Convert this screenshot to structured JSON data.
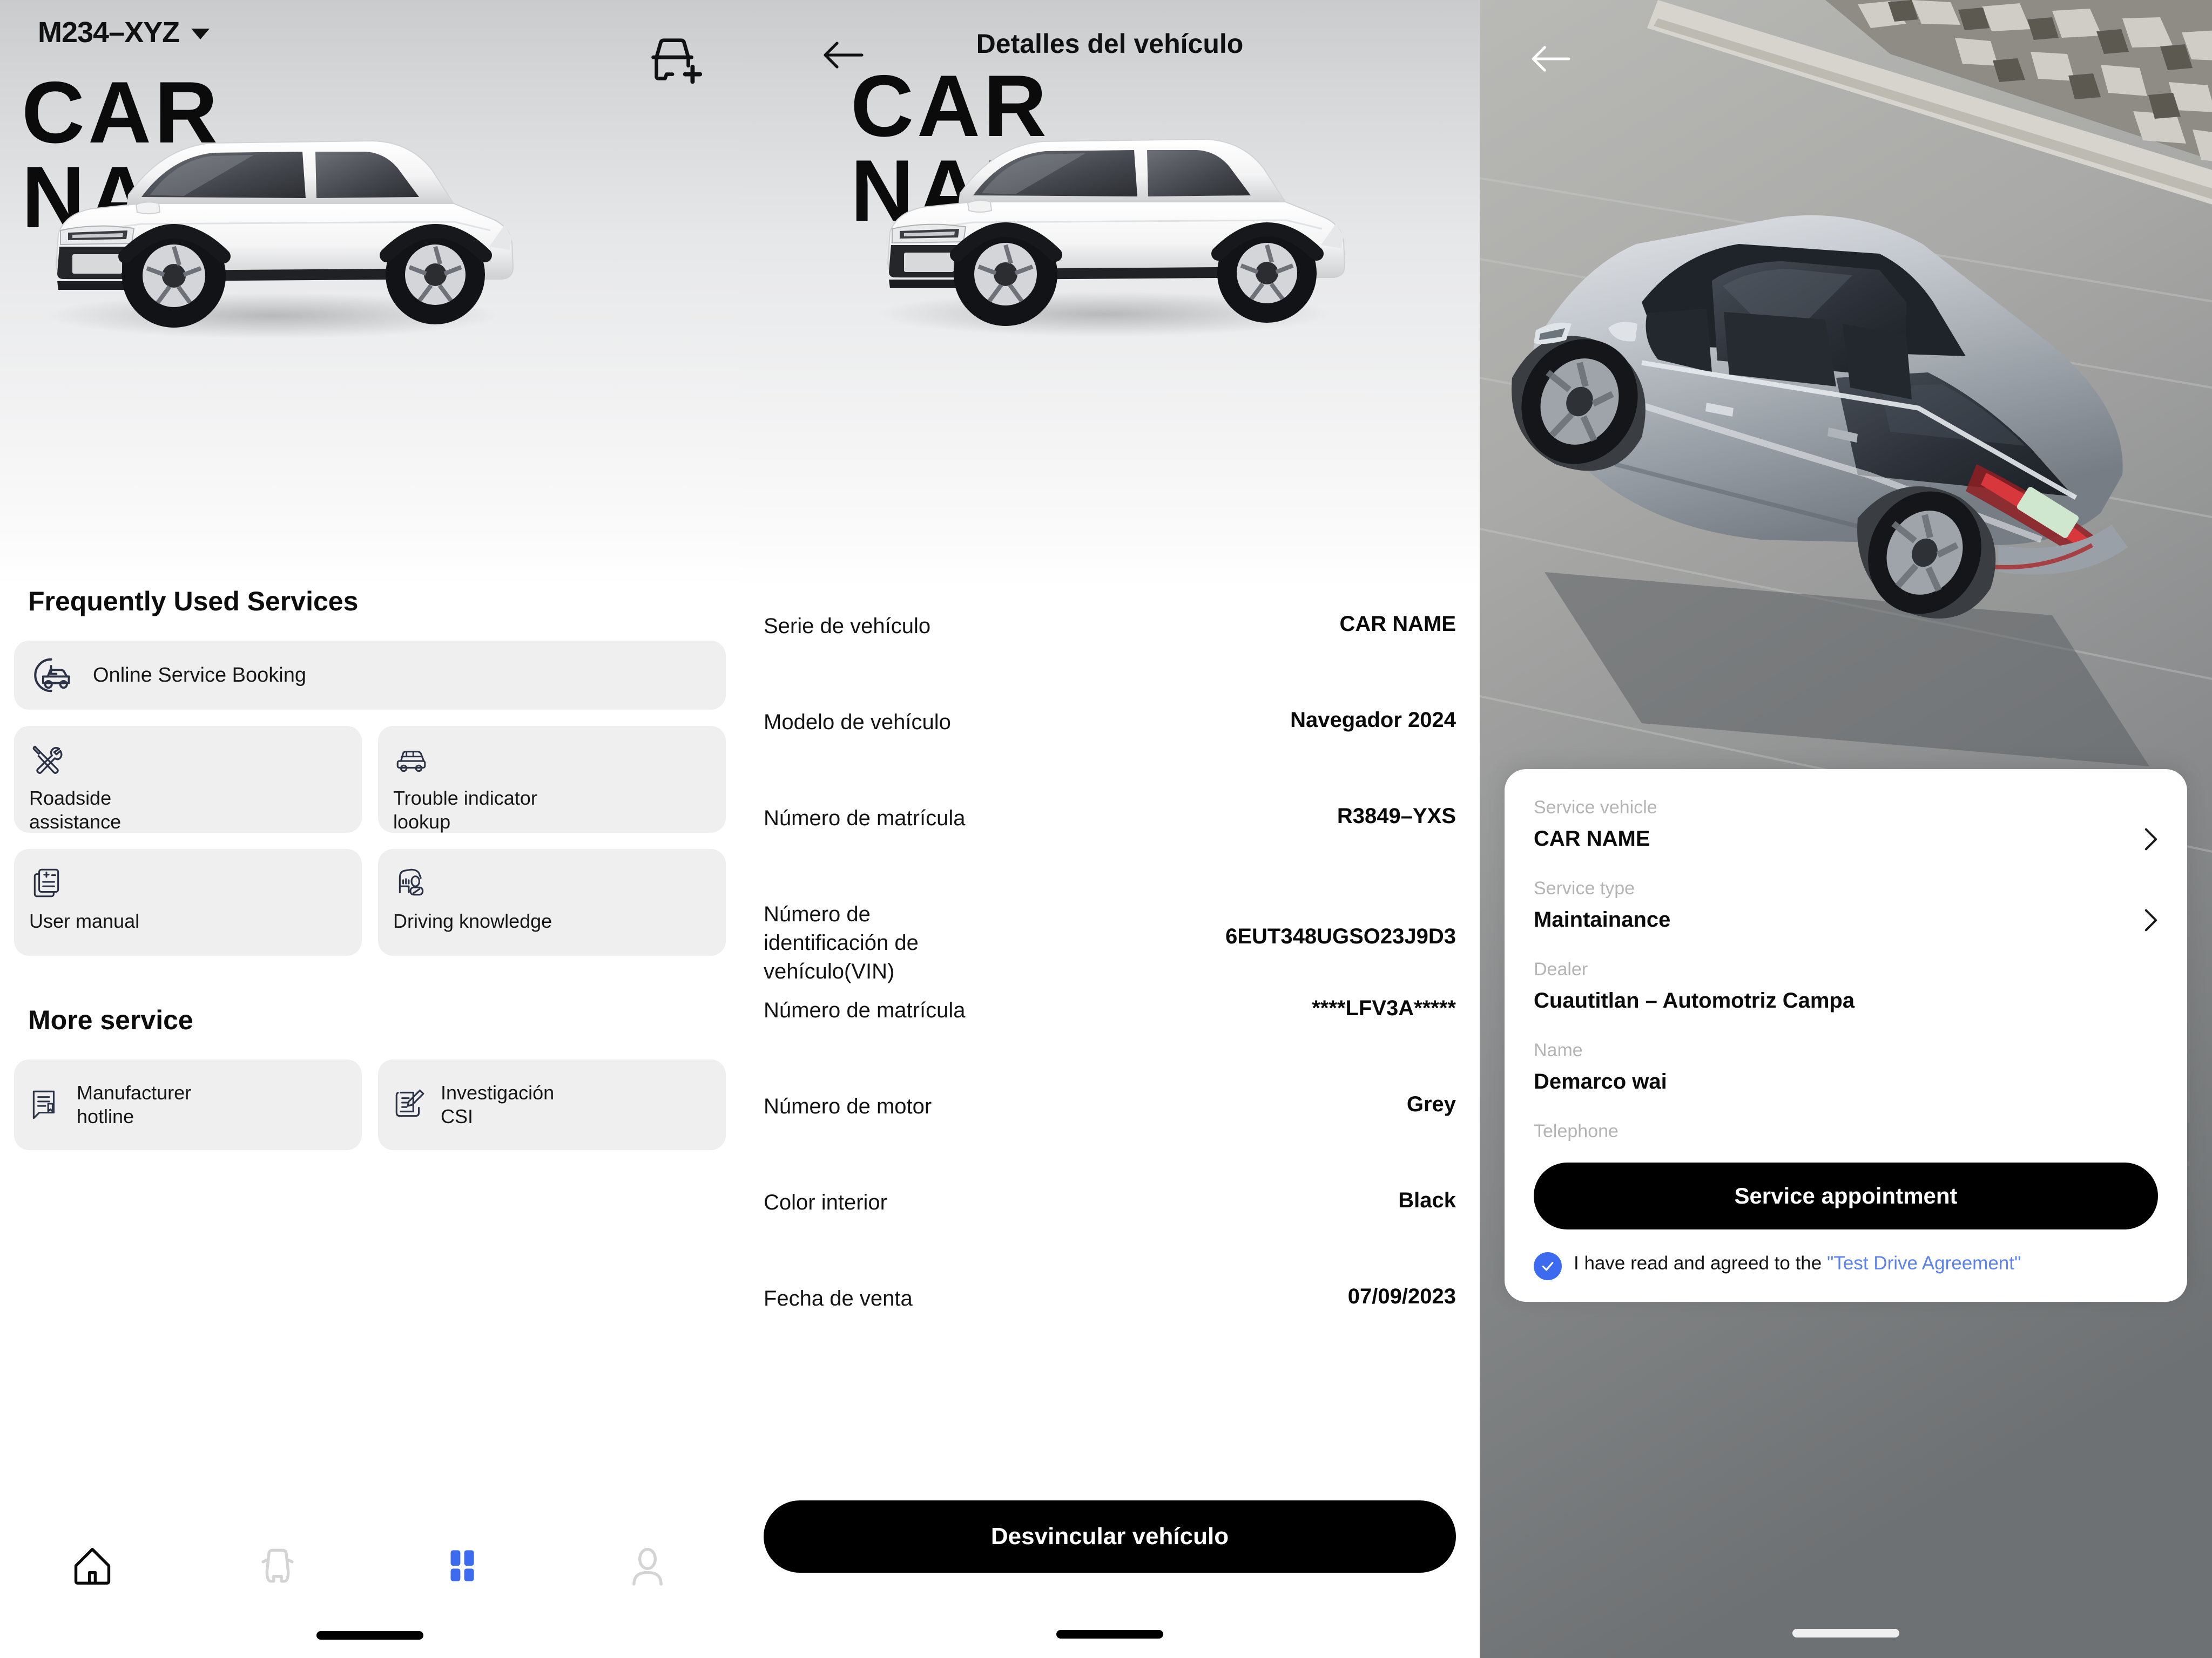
{
  "home": {
    "plate_label": "M234–XYZ",
    "add_vehicle_icon": "car-plus-icon",
    "caret_icon": "chevron-down-icon",
    "hero_line1": "CAR",
    "hero_line2": "NAME",
    "frequently_used_title": "Frequently Used Services",
    "online_booking_label": "Online Service Booking",
    "online_booking_icon": "car-clock-icon",
    "tiles": [
      {
        "label": "Roadside\nassistance",
        "icon": "tools-icon"
      },
      {
        "label": "Trouble indicator\nlookup",
        "icon": "suv-icon"
      },
      {
        "label": "User manual",
        "icon": "document-plus-icon"
      },
      {
        "label": "Driving knowledge",
        "icon": "car-gauge-icon"
      }
    ],
    "more_service_title": "More service",
    "more_tiles": [
      {
        "label": "Manufacturer\nhotline",
        "icon": "document-chat-icon"
      },
      {
        "label": "Investigación\nCSI",
        "icon": "survey-pencil-icon"
      }
    ],
    "bottom_nav": [
      {
        "name": "home",
        "icon": "home-icon",
        "active": true,
        "color": "#0a0a0a"
      },
      {
        "name": "vehicle",
        "icon": "car-icon",
        "active": false,
        "color": "#d4d4d4"
      },
      {
        "name": "services",
        "icon": "grid-icon",
        "active": true,
        "color": "#3d6bf0"
      },
      {
        "name": "profile",
        "icon": "person-icon",
        "active": false,
        "color": "#d4d4d4"
      }
    ]
  },
  "detail": {
    "back_icon": "arrow-left-icon",
    "title": "Detalles del vehículo",
    "hero_line1": "CAR",
    "hero_line2": "NAME",
    "specs": [
      {
        "key": "Serie de vehículo",
        "value": "CAR NAME"
      },
      {
        "key": "Modelo de vehículo",
        "value": "Navegador 2024"
      },
      {
        "key": "Número de matrícula",
        "value": "R3849–YXS"
      },
      {
        "key": "Número de identificación de vehículo(VIN)",
        "value": "6EUT348UGSO23J9D3"
      },
      {
        "key": "Número de matrícula",
        "value": "****LFV3A*****"
      },
      {
        "key": "Número de motor",
        "value": "Grey"
      },
      {
        "key": "Color interior",
        "value": "Black"
      },
      {
        "key": "Fecha de venta",
        "value": "07/09/2023"
      }
    ],
    "unbind_label": "Desvincular vehículo"
  },
  "appointment": {
    "back_icon": "arrow-left-icon",
    "fields": [
      {
        "label": "Service vehicle",
        "value": "CAR NAME",
        "chevron": true
      },
      {
        "label": "Service type",
        "value": "Maintainance",
        "chevron": true
      },
      {
        "label": "Dealer",
        "value": "Cuautitlan – Automotriz Campa",
        "chevron": false
      },
      {
        "label": "Name",
        "value": "Demarco wai",
        "chevron": false
      },
      {
        "label": "Telephone",
        "value": "",
        "chevron": false
      }
    ],
    "submit_label": "Service appointment",
    "agree_prefix": "I have read and agreed to the ",
    "agree_link": "\"Test Drive Agreement\"",
    "checkbox_checked": true,
    "checkbox_icon": "check-icon"
  },
  "colors": {
    "accent_blue": "#3d6bf0",
    "link_blue": "#5b82ef",
    "card_grey": "#efefef",
    "icon_navy": "#2b3245",
    "dark": "#000000"
  }
}
